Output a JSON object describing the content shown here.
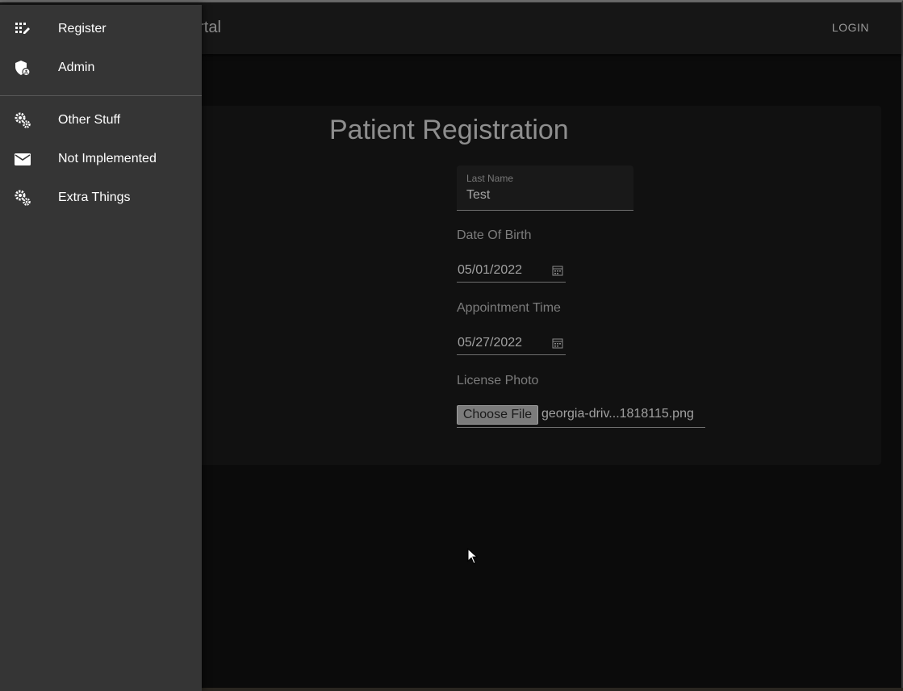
{
  "app_bar": {
    "title": "n Portal",
    "login_label": "LOGIN"
  },
  "form": {
    "title": "Patient Registration",
    "last_name": {
      "label": "Last Name",
      "value": "Test"
    },
    "date_of_birth": {
      "label": "Date Of Birth",
      "value": "05/01/2022",
      "icon": "calendar-icon"
    },
    "appointment_time": {
      "label": "Appointment Time",
      "value": "05/27/2022",
      "icon": "calendar-icon"
    },
    "license_photo": {
      "label": "License Photo",
      "button_label": "Choose File",
      "file_name": "georgia-driv...1818115.png"
    }
  },
  "drawer": {
    "items": [
      {
        "label": "Register",
        "icon": "app-registration-icon"
      },
      {
        "label": "Admin",
        "icon": "admin-shield-icon"
      },
      {
        "label": "Other Stuff",
        "icon": "gears-icon"
      },
      {
        "label": "Not Implemented",
        "icon": "mail-icon"
      },
      {
        "label": "Extra Things",
        "icon": "gears-icon"
      }
    ]
  },
  "colors": {
    "background": "#0b0b0b",
    "app_bar": "#161616",
    "card": "#111111",
    "drawer": "#353535",
    "drawer_text": "#ffffff",
    "muted_text": "#8e8e8e"
  }
}
